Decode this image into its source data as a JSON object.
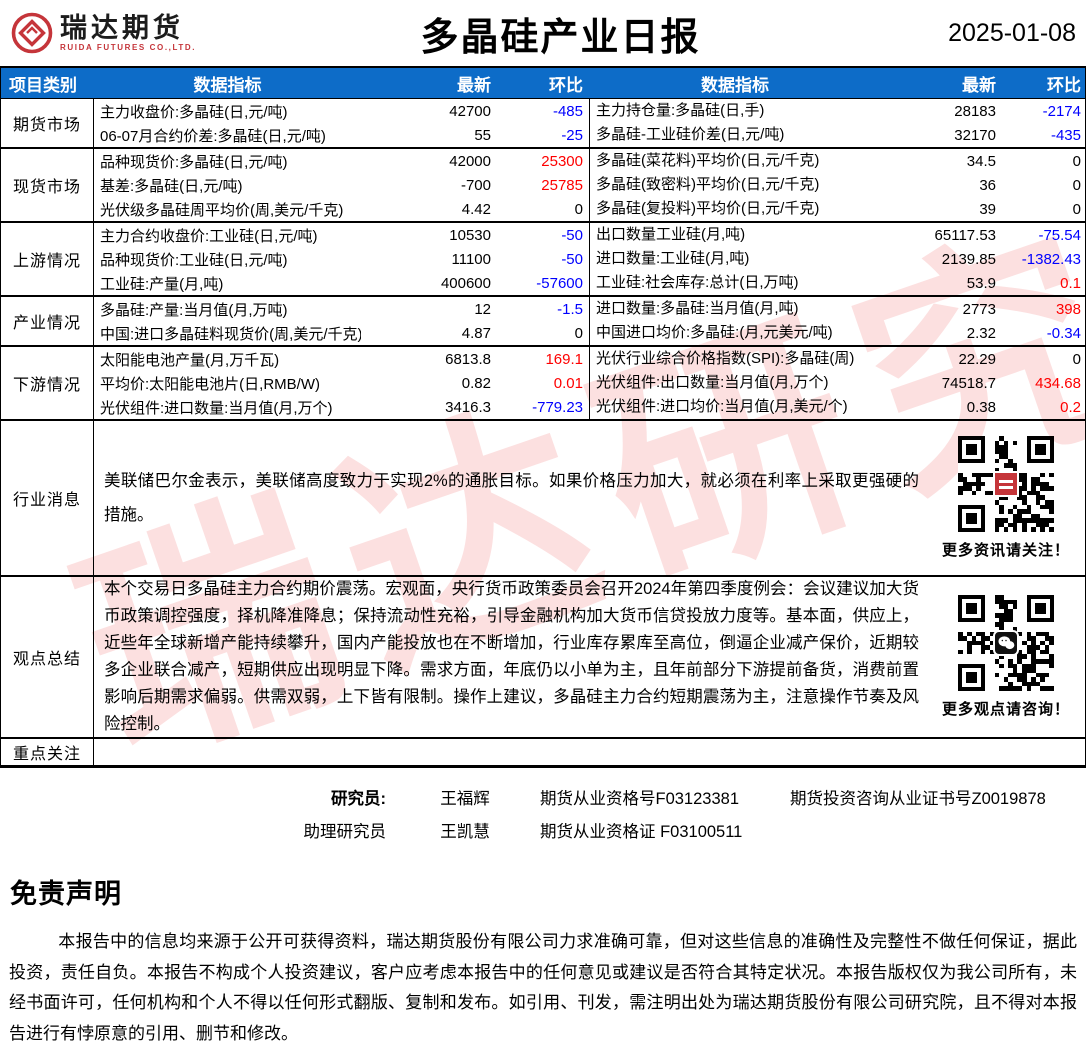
{
  "header": {
    "logo_cn": "瑞达期货",
    "logo_en": "RUIDA FUTURES CO.,LTD.",
    "title": "多晶硅产业日报",
    "date": "2025-01-08"
  },
  "colors": {
    "header_bg": "#0d6cc8",
    "up_red": "#fe0000",
    "down_blue": "#0000fe",
    "logo_red": "#c5353a",
    "watermark_pink": "#f28282"
  },
  "watermark": "瑞达研究",
  "table": {
    "columns": [
      "项目类别",
      "数据指标",
      "最新",
      "环比",
      "数据指标",
      "最新",
      "环比"
    ],
    "sections": [
      {
        "label": "期货市场"
      },
      {
        "label": "现货市场"
      },
      {
        "label": "上游情况"
      },
      {
        "label": "产业情况"
      },
      {
        "label": "下游情况"
      }
    ],
    "rows": [
      {
        "i1": "主力收盘价:多晶硅(日,元/吨)",
        "v1": "42700",
        "c1": "-485",
        "k1": "#0000fe",
        "i2": "主力持仓量:多晶硅(日,手)",
        "v2": "28183",
        "c2": "-2174",
        "k2": "#0000fe"
      },
      {
        "i1": "06-07月合约价差:多晶硅(日,元/吨)",
        "v1": "55",
        "c1": "-25",
        "k1": "#0000fe",
        "i2": "多晶硅-工业硅价差(日,元/吨)",
        "v2": "32170",
        "c2": "-435",
        "k2": "#0000fe"
      },
      {
        "i1": "品种现货价:多晶硅(日,元/吨)",
        "v1": "42000",
        "c1": "25300",
        "k1": "#fe0000",
        "i2": "多晶硅(菜花料)平均价(日,元/千克)",
        "v2": "34.5",
        "c2": "0",
        "k2": "#000000"
      },
      {
        "i1": "基差:多晶硅(日,元/吨)",
        "v1": "-700",
        "c1": "25785",
        "k1": "#fe0000",
        "i2": "多晶硅(致密料)平均价(日,元/千克)",
        "v2": "36",
        "c2": "0",
        "k2": "#000000"
      },
      {
        "i1": "光伏级多晶硅周平均价(周,美元/千克)",
        "v1": "4.42",
        "c1": "0",
        "k1": "#000000",
        "i2": "多晶硅(复投料)平均价(日,元/千克)",
        "v2": "39",
        "c2": "0",
        "k2": "#000000"
      },
      {
        "i1": "主力合约收盘价:工业硅(日,元/吨)",
        "v1": "10530",
        "c1": "-50",
        "k1": "#0000fe",
        "i2": "出口数量工业硅(月,吨)",
        "v2": "65117.53",
        "c2": "-75.54",
        "k2": "#0000fe"
      },
      {
        "i1": "品种现货价:工业硅(日,元/吨)",
        "v1": "11100",
        "c1": "-50",
        "k1": "#0000fe",
        "i2": "进口数量:工业硅(月,吨)",
        "v2": "2139.85",
        "c2": "-1382.43",
        "k2": "#0000fe"
      },
      {
        "i1": "工业硅:产量(月,吨)",
        "v1": "400600",
        "c1": "-57600",
        "k1": "#0000fe",
        "i2": "工业硅:社会库存:总计(日,万吨)",
        "v2": "53.9",
        "c2": "0.1",
        "k2": "#fe0000"
      },
      {
        "i1": "多晶硅:产量:当月值(月,万吨)",
        "v1": "12",
        "c1": "-1.5",
        "k1": "#0000fe",
        "i2": "进口数量:多晶硅:当月值(月,吨)",
        "v2": "2773",
        "c2": "398",
        "k2": "#fe0000"
      },
      {
        "i1": "中国:进口多晶硅料现货价(周,美元/千克)",
        "v1": "4.87",
        "c1": "0",
        "k1": "#000000",
        "i2": "中国进口均价:多晶硅:(月,元美元/吨)",
        "v2": "2.32",
        "c2": "-0.34",
        "k2": "#0000fe"
      },
      {
        "i1": "太阳能电池产量(月,万千瓦)",
        "v1": "6813.8",
        "c1": "169.1",
        "k1": "#fe0000",
        "i2": "光伏行业综合价格指数(SPI):多晶硅(周)",
        "v2": "22.29",
        "c2": "0",
        "k2": "#000000"
      },
      {
        "i1": "平均价:太阳能电池片(日,RMB/W)",
        "v1": "0.82",
        "c1": "0.01",
        "k1": "#fe0000",
        "i2": "光伏组件:出口数量:当月值(月,万个)",
        "v2": "74518.7",
        "c2": "434.68",
        "k2": "#fe0000"
      },
      {
        "i1": "光伏组件:进口数量:当月值(月,万个)",
        "v1": "3416.3",
        "c1": "-779.23",
        "k1": "#0000fe",
        "i2": "光伏组件:进口均价:当月值(月,美元/个)",
        "v2": "0.38",
        "c2": "0.2",
        "k2": "#fe0000"
      }
    ]
  },
  "news": {
    "label": "行业消息",
    "text": "美联储巴尔金表示，美联储高度致力于实现2%的通胀目标。如果价格压力加大，就必须在利率上采取更强硬的措施。",
    "qr_icon": "research-qr-code",
    "qr_caption": "更多资讯请关注！"
  },
  "summary": {
    "label": "观点总结",
    "text": "本个交易日多晶硅主力合约期价震荡。宏观面，央行货币政策委员会召开2024年第四季度例会：会议建议加大货币政策调控强度，择机降准降息；保持流动性充裕，引导金融机构加大货币信贷投放力度等。基本面，供应上，近些年全球新增产能持续攀升，国内产能投放也在不断增加，行业库存累库至高位，倒逼企业减产保价，近期较多企业联合减产，短期供应出现明显下降。需求方面，年底仍以小单为主，且年前部分下游提前备货，消费前置影响后期需求偏弱。供需双弱，上下皆有限制。操作上建议，多晶硅主力合约短期震荡为主，注意操作节奏及风险控制。",
    "qr_icon": "wechat-qr-code",
    "qr_caption": "更多观点请咨询！"
  },
  "focus": {
    "label": "重点关注",
    "content": ""
  },
  "researchers": {
    "line1": {
      "label": "研究员:",
      "name": "王福辉",
      "cert1": "期货从业资格号F03123381",
      "cert2": "期货投资咨询从业证书号Z0019878"
    },
    "line2": {
      "label": "助理研究员",
      "name": "王凯慧",
      "cert1": "期货从业资格证 F03100511",
      "cert2": ""
    }
  },
  "disclaimer": {
    "title": "免责声明",
    "body": "本报告中的信息均来源于公开可获得资料，瑞达期货股份有限公司力求准确可靠，但对这些信息的准确性及完整性不做任何保证，据此投资，责任自负。本报告不构成个人投资建议，客户应考虑本报告中的任何意见或建议是否符合其特定状况。本报告版权仅为我公司所有，未经书面许可，任何机构和个人不得以任何形式翻版、复制和发布。如引用、刊发，需注明出处为瑞达期货股份有限公司研究院，且不得对本报告进行有悖原意的引用、删节和修改。"
  }
}
